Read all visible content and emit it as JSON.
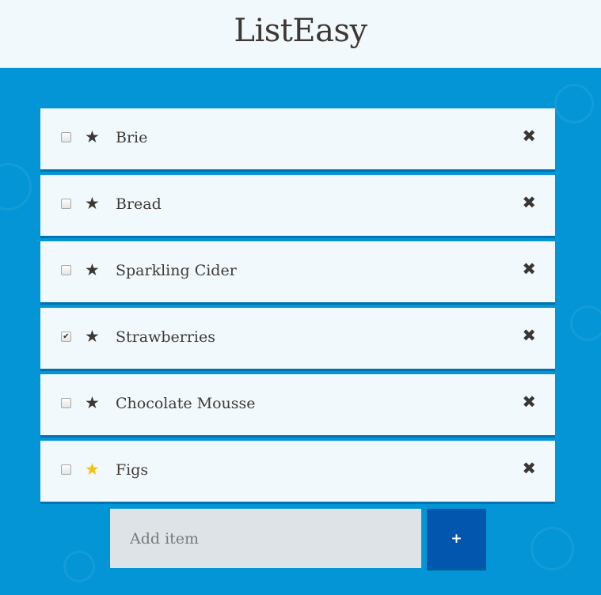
{
  "app": {
    "title": "ListEasy"
  },
  "items": [
    {
      "label": "Brie",
      "checked": false,
      "starred": false
    },
    {
      "label": "Bread",
      "checked": false,
      "starred": false
    },
    {
      "label": "Sparkling Cider",
      "checked": false,
      "starred": false
    },
    {
      "label": "Strawberries",
      "checked": true,
      "starred": false
    },
    {
      "label": "Chocolate Mousse",
      "checked": false,
      "starred": false
    },
    {
      "label": "Figs",
      "checked": false,
      "starred": true
    }
  ],
  "icons": {
    "star": "★",
    "delete": "✖",
    "check": "✔"
  },
  "add": {
    "placeholder": "Add item",
    "button_label": "+"
  },
  "colors": {
    "background": "#0395d6",
    "header": "#f2f9fc",
    "card": "#f2f9fc",
    "star_default": "#3b3735",
    "star_active": "#f4c20d",
    "add_button": "#0356ad"
  }
}
